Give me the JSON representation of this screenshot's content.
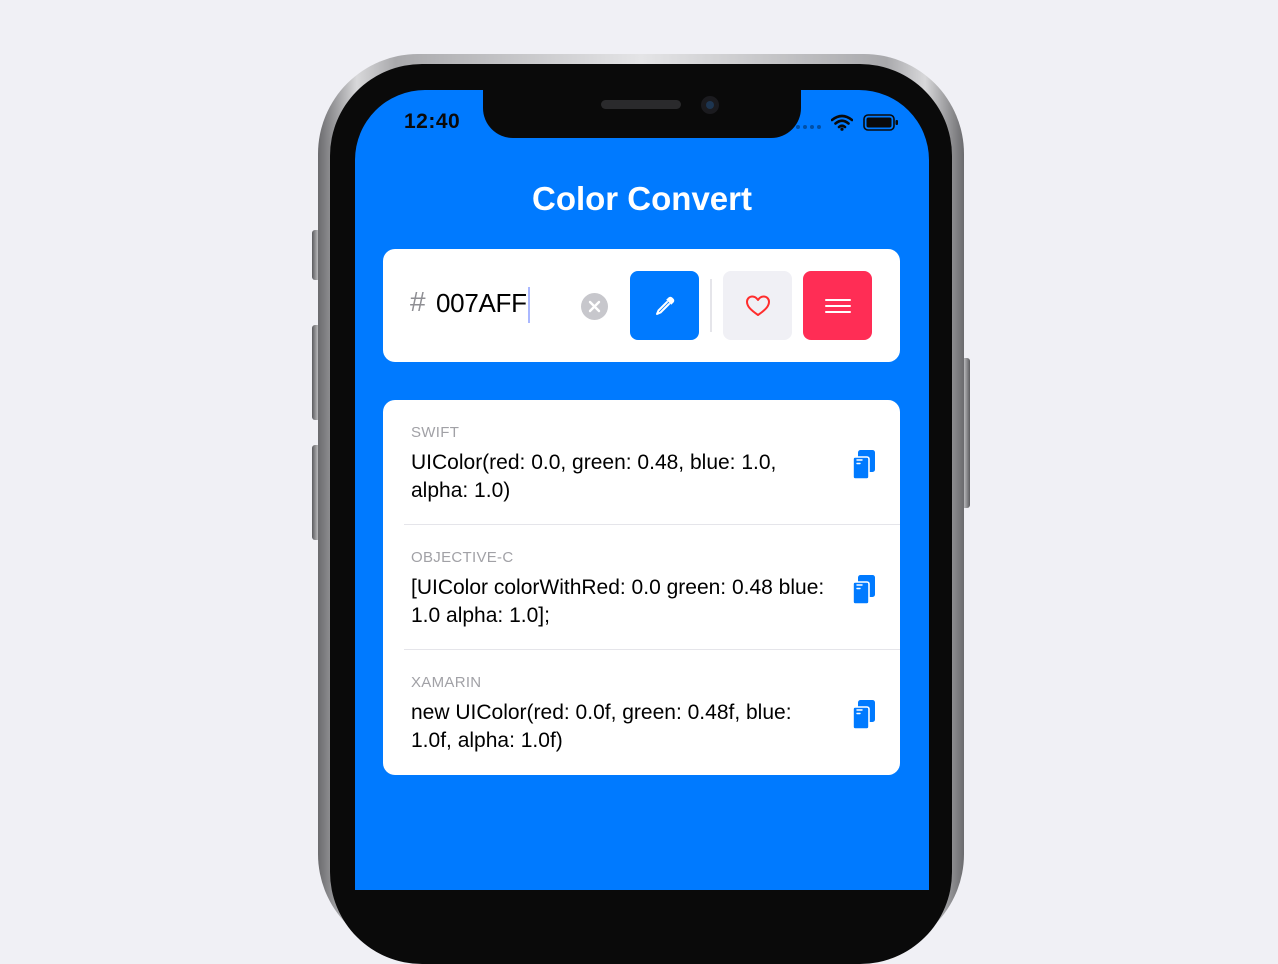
{
  "status_bar": {
    "time": "12:40"
  },
  "app": {
    "title": "Color Convert",
    "accent_color": "#007aff",
    "menu_color": "#ff2d55"
  },
  "input": {
    "prefix": "#",
    "value": "007AFF",
    "clear_icon": "clear-circle-icon",
    "picker_icon": "eyedropper-icon",
    "favorite_icon": "heart-icon",
    "menu_icon": "hamburger-menu-icon"
  },
  "results": [
    {
      "label": "SWIFT",
      "code": "UIColor(red: 0.0, green: 0.48, blue: 1.0, alpha: 1.0)",
      "copy_icon": "copy-icon"
    },
    {
      "label": "OBJECTIVE-C",
      "code": "[UIColor colorWithRed: 0.0 green: 0.48 blue: 1.0 alpha: 1.0];",
      "copy_icon": "copy-icon"
    },
    {
      "label": "XAMARIN",
      "code": "new UIColor(red: 0.0f, green: 0.48f, blue: 1.0f, alpha: 1.0f)",
      "copy_icon": "copy-icon"
    }
  ]
}
